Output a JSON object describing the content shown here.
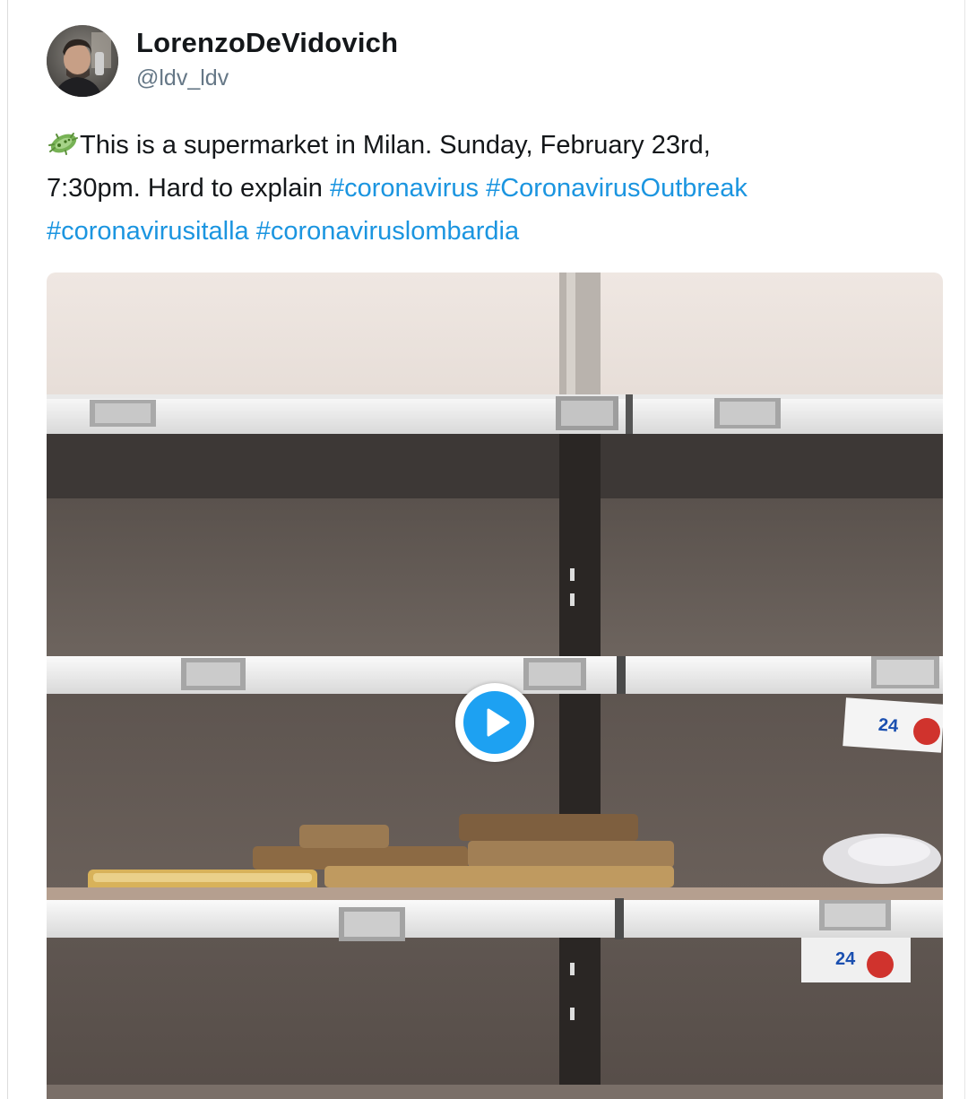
{
  "tweet": {
    "author": {
      "display_name": "LorenzoDeVidovich",
      "handle": "@ldv_ldv",
      "avatar_icon": "user-avatar"
    },
    "text": {
      "emoji_icon": "microbe-emoji-icon",
      "line1": "This is a supermarket in Milan. Sunday, February 23rd,",
      "line2_plain": "7:30pm. Hard to explain ",
      "hashtags": [
        "#coronavirus",
        "#CoronavirusOutbreak",
        "#coronavirusitalla",
        "#coronaviruslombardia"
      ]
    },
    "media": {
      "type": "video",
      "play_icon": "play-icon"
    }
  },
  "colors": {
    "link": "#1b95e0",
    "text": "#14171a",
    "handle": "#657786",
    "play_button": "#1da1f2"
  }
}
